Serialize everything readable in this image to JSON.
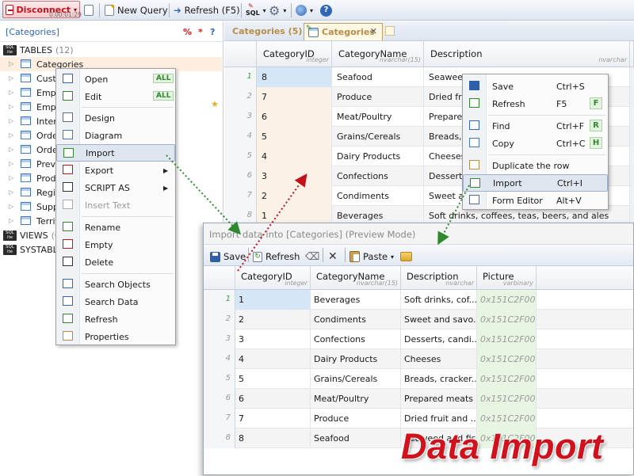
{
  "toolbar": {
    "disconnect_label": "Disconnect",
    "timer": "0.00:01:29",
    "new_query_label": "New Query",
    "refresh_label": "Refresh (F5)",
    "sql_label": "SQL"
  },
  "tree": {
    "filter_text": "[Categories]",
    "filter_pct": "%",
    "filter_star": "*",
    "filter_help": "?",
    "tables_label": "TABLES",
    "tables_count": "(12)",
    "views_label": "VIEWS",
    "views_count": "(0",
    "systables_label": "SYSTABLES",
    "items": [
      "Categories",
      "Cust",
      "Empl",
      "Empl",
      "Inter",
      "Orde",
      "Orde",
      "Previ",
      "Prod",
      "Regi",
      "Supp",
      "Territ"
    ]
  },
  "context_menu_left": {
    "items": [
      {
        "label": "Open",
        "badge": "ALL"
      },
      {
        "label": "Edit",
        "badge": "ALL"
      },
      {
        "label": "Design"
      },
      {
        "label": "Diagram"
      },
      {
        "label": "Import"
      },
      {
        "label": "Export"
      },
      {
        "label": "SCRIPT AS"
      },
      {
        "label": "Insert Text"
      },
      {
        "label": "Rename"
      },
      {
        "label": "Empty"
      },
      {
        "label": "Delete"
      },
      {
        "label": "Search Objects"
      },
      {
        "label": "Search Data"
      },
      {
        "label": "Refresh"
      },
      {
        "label": "Properties"
      }
    ]
  },
  "tabs": {
    "tab1": "Categories (5)",
    "tab2": "Categories"
  },
  "main_grid": {
    "columns": [
      {
        "name": "CategoryID",
        "type": "integer"
      },
      {
        "name": "CategoryName",
        "type": "nvarchar(15)"
      },
      {
        "name": "Description",
        "type": "nvarchar"
      }
    ],
    "rows": [
      {
        "n": "1",
        "id": "8",
        "name": "Seafood",
        "desc": "Seaweed and fish"
      },
      {
        "n": "2",
        "id": "7",
        "name": "Produce",
        "desc": "Dried fruit"
      },
      {
        "n": "3",
        "id": "6",
        "name": "Meat/Poultry",
        "desc": "Prepared"
      },
      {
        "n": "4",
        "id": "5",
        "name": "Grains/Cereals",
        "desc": "Breads, c"
      },
      {
        "n": "5",
        "id": "4",
        "name": "Dairy Products",
        "desc": "Cheeses"
      },
      {
        "n": "6",
        "id": "3",
        "name": "Confections",
        "desc": "Desserts,"
      },
      {
        "n": "7",
        "id": "2",
        "name": "Condiments",
        "desc": "Sweet and"
      },
      {
        "n": "8",
        "id": "1",
        "name": "Beverages",
        "desc": "Soft drinks, coffees, teas, beers, and ales"
      }
    ]
  },
  "context_menu_right": {
    "items": [
      {
        "label": "Save",
        "shortcut": "Ctrl+S",
        "key": ""
      },
      {
        "label": "Refresh",
        "shortcut": "F5",
        "key": "F"
      },
      {
        "label": "Find",
        "shortcut": "Ctrl+F",
        "key": "R"
      },
      {
        "label": "Copy",
        "shortcut": "Ctrl+C",
        "key": "H"
      },
      {
        "label": "Duplicate the row",
        "shortcut": "",
        "key": ""
      },
      {
        "label": "Import",
        "shortcut": "Ctrl+I",
        "key": ""
      },
      {
        "label": "Form Editor",
        "shortcut": "Alt+V",
        "key": ""
      }
    ]
  },
  "import_window": {
    "title": "Import data into [Categories] (Preview Mode)",
    "save_label": "Save",
    "refresh_label": "Refresh",
    "paste_label": "Paste",
    "columns": [
      {
        "name": "CategoryID",
        "type": "integer"
      },
      {
        "name": "CategoryName",
        "type": "nvarchar(15)"
      },
      {
        "name": "Description",
        "type": "nvarchar"
      },
      {
        "name": "Picture",
        "type": "varbinary"
      }
    ],
    "rows": [
      {
        "n": "1",
        "id": "1",
        "name": "Beverages",
        "desc": "Soft drinks, cof...",
        "pic": "0x151C2F00..."
      },
      {
        "n": "2",
        "id": "2",
        "name": "Condiments",
        "desc": "Sweet and savo...",
        "pic": "0x151C2F00..."
      },
      {
        "n": "3",
        "id": "3",
        "name": "Confections",
        "desc": "Desserts, candi...",
        "pic": "0x151C2F00..."
      },
      {
        "n": "4",
        "id": "4",
        "name": "Dairy Products",
        "desc": "Cheeses",
        "pic": "0x151C2F00..."
      },
      {
        "n": "5",
        "id": "5",
        "name": "Grains/Cereals",
        "desc": "Breads, cracker...",
        "pic": "0x151C2F00..."
      },
      {
        "n": "6",
        "id": "6",
        "name": "Meat/Poultry",
        "desc": "Prepared meats",
        "pic": "0x151C2F00..."
      },
      {
        "n": "7",
        "id": "7",
        "name": "Produce",
        "desc": "Dried fruit and ...",
        "pic": "0x151C2F00..."
      },
      {
        "n": "8",
        "id": "8",
        "name": "Seafood",
        "desc": "Seaweed and fish",
        "pic": "0x151C2F00..."
      }
    ]
  },
  "banner_text": "Data Import",
  "colors": {
    "accent_red": "#d1121c",
    "tab_gold": "#b88d4a",
    "badge_green": "#2f8a2f",
    "selection_blue": "#d5e6f7"
  }
}
